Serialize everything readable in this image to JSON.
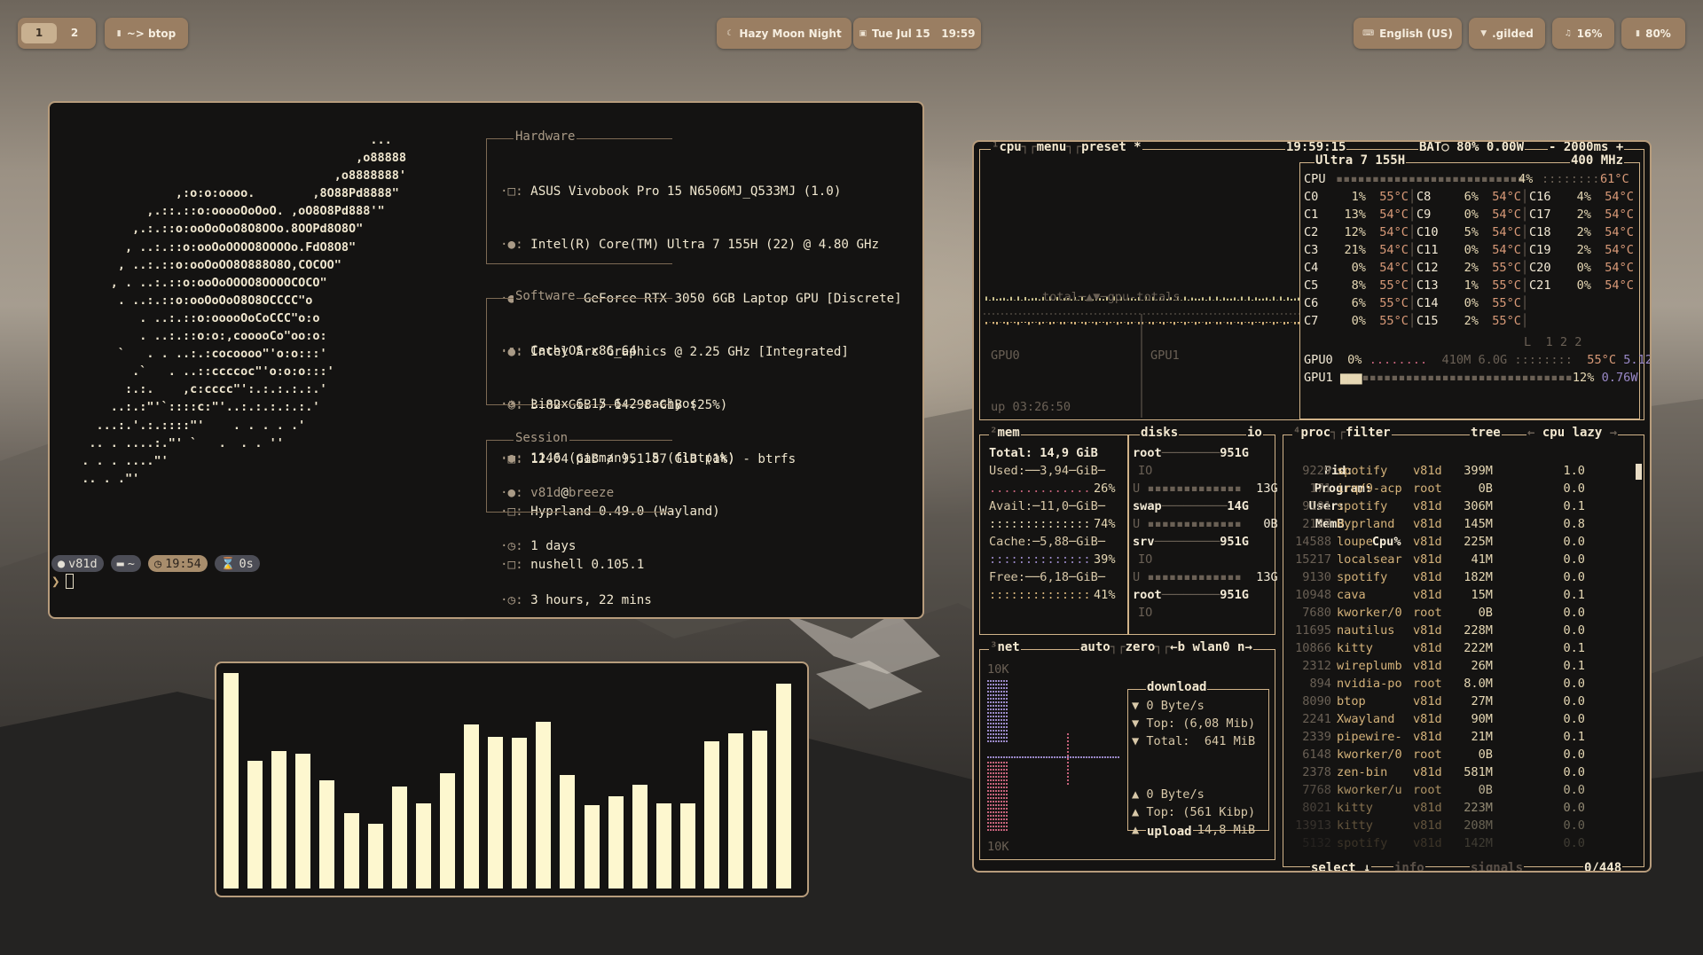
{
  "topbar": {
    "workspaces": [
      "1",
      "2"
    ],
    "active_workspace": "1",
    "window_title": "~> btop",
    "theme": "Hazy Moon Night",
    "datetime": "Tue Jul 15   19:59",
    "keyboard": "English (US)",
    "network": ".gilded",
    "volume": "16%",
    "battery": "80%"
  },
  "fastfetch": {
    "logo_lines": [
      "                                          ...",
      "                                        ,o88888",
      "                                     ,o8888888'",
      "               ,:o:o:oooo.        ,8O88Pd8888\"",
      "           ,.::.::o:ooooOoOoO. ,oO8O8Pd888'\"",
      "         ,.:.::o:ooOoOoO8O8OOo.8OOPd8O8O\"",
      "        , ..:.::o:ooOoOOOO8OOOOo.FdO8O8\"",
      "       , ..:.::o:ooOoOO8O888O8O,COCOO\"",
      "      , . ..:.::o:ooOoOOOO8OOOOCOCO\"",
      "       . ..:.::o:ooOoOoO8O8OCCCC\"o",
      "          . ..:.::o:ooooOoCoCCC\"o:o",
      "          . ..:.::o:o:,cooooCo\"oo:o:",
      "       `   . . ..:.:cocoooo\"'o:o:::'",
      "         .`   . ..::ccccoc\"'o:o:o:::'",
      "        :.:.    ,c:cccc\"':.:.:.:.:.'",
      "      ..:.:\"'`::::c:\"'..:.:.:.:.:.'",
      "    ...:.'.:.::::\"'    . . . . .'",
      "   .. . ....:.\"' `   .  . . ''",
      "  . . . ....\"'",
      "  .. . .\"'"
    ],
    "hardware": {
      "title": "Hardware",
      "lines": [
        "ASUS Vivobook Pro 15 N6506MJ_Q533MJ (1.0)",
        "Intel(R) Core(TM) Ultra 7 155H (22) @ 4.80 GHz",
        "NVIDIA GeForce RTX 3050 6GB Laptop GPU [Discrete]",
        "Intel Arc Graphics @ 2.25 GHz [Integrated]",
        "3.82 GiB / 14.98 GiB (25%)",
        "12.04 GiB / 951.87 GiB (1%) - btrfs"
      ]
    },
    "software": {
      "title": "Software",
      "lines": [
        "CachyOS x86_64",
        "Linux 6.15.6-2-cachyos",
        "1146 (pacman), 15 (flatpak)",
        "Hyprland 0.49.0 (Wayland)",
        "nushell 0.105.1"
      ]
    },
    "session": {
      "title": "Session",
      "user": "v81d",
      "at": "@",
      "host": "breeze",
      "lines": [
        "1 days",
        "3 hours, 22 mins"
      ]
    },
    "prompt": {
      "user": "v81d",
      "dir": "~",
      "time": "19:54",
      "duration": "0s",
      "symbol": "❯"
    }
  },
  "cava": {
    "levels": [
      0.973,
      0.574,
      0.62,
      0.606,
      0.486,
      0.339,
      0.29,
      0.458,
      0.384,
      0.521,
      0.74,
      0.685,
      0.678,
      0.75,
      0.51,
      0.376,
      0.414,
      0.466,
      0.384,
      0.384,
      0.664,
      0.699,
      0.71,
      0.924
    ]
  },
  "btop": {
    "cpu": {
      "tab": "cpu",
      "menu": "menu",
      "preset": "preset *",
      "clock": "19:59:15",
      "battery": "BAT○ 80% 0.00W",
      "rate": "- 2000ms +",
      "model": "Ultra 7 155H",
      "freq": "400 MHz",
      "total_pct": "4%",
      "total_temp": "61°C",
      "graph_label": "total─▲▼─gpu-totals",
      "gpu0_label": "GPU0",
      "gpu1_label": "GPU1",
      "uptime": "up 03:26:50",
      "load": "L  1 2 2",
      "cores": [
        {
          "n": "C0",
          "p": "1%",
          "t": "55°C"
        },
        {
          "n": "C1",
          "p": "13%",
          "t": "54°C"
        },
        {
          "n": "C2",
          "p": "12%",
          "t": "54°C"
        },
        {
          "n": "C3",
          "p": "21%",
          "t": "54°C"
        },
        {
          "n": "C4",
          "p": "0%",
          "t": "54°C"
        },
        {
          "n": "C5",
          "p": "8%",
          "t": "55°C"
        },
        {
          "n": "C6",
          "p": "6%",
          "t": "55°C"
        },
        {
          "n": "C7",
          "p": "0%",
          "t": "55°C"
        },
        {
          "n": "C8",
          "p": "6%",
          "t": "54°C"
        },
        {
          "n": "C9",
          "p": "0%",
          "t": "54°C"
        },
        {
          "n": "C10",
          "p": "5%",
          "t": "54°C"
        },
        {
          "n": "C11",
          "p": "0%",
          "t": "54°C"
        },
        {
          "n": "C12",
          "p": "2%",
          "t": "55°C"
        },
        {
          "n": "C13",
          "p": "1%",
          "t": "55°C"
        },
        {
          "n": "C14",
          "p": "0%",
          "t": "55°C"
        },
        {
          "n": "C15",
          "p": "2%",
          "t": "55°C"
        },
        {
          "n": "C16",
          "p": "4%",
          "t": "54°C"
        },
        {
          "n": "C17",
          "p": "2%",
          "t": "54°C"
        },
        {
          "n": "C18",
          "p": "2%",
          "t": "54°C"
        },
        {
          "n": "C19",
          "p": "2%",
          "t": "54°C"
        },
        {
          "n": "C20",
          "p": "0%",
          "t": "54°C"
        },
        {
          "n": "C21",
          "p": "0%",
          "t": "54°C"
        }
      ],
      "gpu0": {
        "name": "GPU0",
        "pct": "0%",
        "mem": "410M 6.0G",
        "temp": "55°C",
        "watt": "5.12W"
      },
      "gpu1": {
        "name": "GPU1",
        "pct": "12%",
        "watt": "0.76W"
      }
    },
    "mem": {
      "tab": "mem",
      "total": "Total: 14,9 GiB",
      "used": "Used:──3,94─GiB─",
      "used_pct": "26%",
      "avail": "Avail:─11,0─GiB─",
      "avail_pct": "74%",
      "cache": "Cache:─5,88─GiB─",
      "cache_pct": "39%",
      "free": "Free:──6,18─GiB─",
      "free_pct": "41%"
    },
    "disks": {
      "tab": "disks",
      "io": "io",
      "list": [
        {
          "name": "root",
          "size": "951G",
          "io": "IO",
          "u": "U",
          "free": "13G"
        },
        {
          "name": "swap",
          "size": "14G",
          "io": "U",
          "free": "0B"
        },
        {
          "name": "srv",
          "size": "951G",
          "io": "IO",
          "u": "U",
          "free": "13G"
        },
        {
          "name": "root",
          "size": "951G",
          "io": "IO"
        }
      ]
    },
    "net": {
      "tab": "net",
      "auto": "auto",
      "zero": "zero",
      "b": "←b",
      "iface": "wlan0",
      "n": "n→",
      "top_scale": "10K",
      "bottom_scale": "10K",
      "download_title": "download",
      "upload_title": "upload",
      "down": [
        "▼ 0 Byte/s",
        "▼ Top: (6,08 Mib)",
        "▼ Total:  641 MiB"
      ],
      "up": [
        "▲ 0 Byte/s",
        "▲ Top: (561 Kibp)",
        "▲ Total: 14,8 MiB"
      ]
    },
    "proc": {
      "tab": "proc",
      "filter": "filter",
      "tree": "tree",
      "sort": "cpu lazy",
      "headers": [
        "Pid:",
        "Program:",
        "User:",
        "MemB",
        "Cpu%"
      ],
      "select": "select ↓",
      "info": "info",
      "signals": "signals",
      "count": "0/448",
      "rows": [
        [
          "9229",
          "spotify",
          "v81d",
          "399M",
          "1.0"
        ],
        [
          "171",
          "irq/9-acp",
          "root",
          "0B",
          "0.0"
        ],
        [
          "9101",
          "spotify",
          "v81d",
          "306M",
          "0.1"
        ],
        [
          "2127",
          "Hyprland",
          "v81d",
          "145M",
          "0.8"
        ],
        [
          "14588",
          "loupe",
          "v81d",
          "225M",
          "0.0"
        ],
        [
          "15217",
          "localsear",
          "v81d",
          "41M",
          "0.0"
        ],
        [
          "9130",
          "spotify",
          "v81d",
          "182M",
          "0.0"
        ],
        [
          "10948",
          "cava",
          "v81d",
          "15M",
          "0.1"
        ],
        [
          "7680",
          "kworker/0",
          "root",
          "0B",
          "0.0"
        ],
        [
          "11695",
          "nautilus",
          "v81d",
          "228M",
          "0.0"
        ],
        [
          "10866",
          "kitty",
          "v81d",
          "222M",
          "0.1"
        ],
        [
          "2312",
          "wireplumb",
          "v81d",
          "26M",
          "0.1"
        ],
        [
          "894",
          "nvidia-po",
          "root",
          "8.0M",
          "0.0"
        ],
        [
          "8090",
          "btop",
          "v81d",
          "27M",
          "0.0"
        ],
        [
          "2241",
          "Xwayland",
          "v81d",
          "90M",
          "0.0"
        ],
        [
          "2339",
          "pipewire-",
          "v81d",
          "21M",
          "0.1"
        ],
        [
          "6148",
          "kworker/0",
          "root",
          "0B",
          "0.0"
        ],
        [
          "2378",
          "zen-bin",
          "v81d",
          "581M",
          "0.0"
        ],
        [
          "7768",
          "kworker/u",
          "root",
          "0B",
          "0.0"
        ],
        [
          "8021",
          "kitty",
          "v81d",
          "223M",
          "0.0"
        ],
        [
          "13913",
          "kitty",
          "v81d",
          "208M",
          "0.0"
        ],
        [
          "5132",
          "spotify",
          "v81d",
          "142M",
          "0.0"
        ]
      ]
    }
  }
}
